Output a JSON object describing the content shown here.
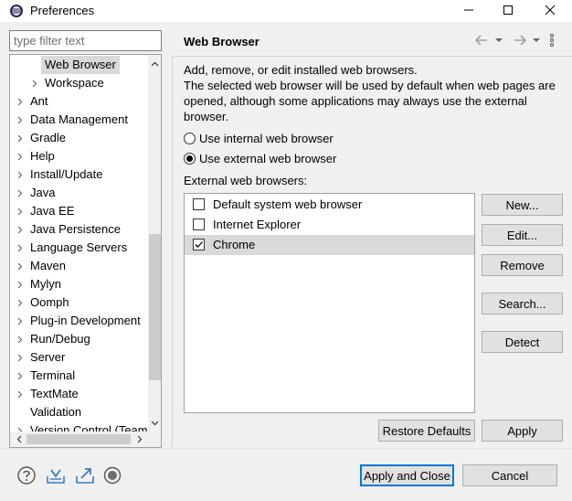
{
  "window": {
    "title": "Preferences",
    "icon": "eclipse-icon",
    "controls": {
      "minimize": "minimize-icon",
      "maximize": "maximize-icon",
      "close": "close-icon"
    }
  },
  "filter": {
    "placeholder": "type filter text",
    "value": ""
  },
  "tree": {
    "items": [
      {
        "label": "Web Browser",
        "expandable": false,
        "selected": true
      },
      {
        "label": "Workspace",
        "expandable": true
      },
      {
        "label": "Ant",
        "expandable": true
      },
      {
        "label": "Data Management",
        "expandable": true
      },
      {
        "label": "Gradle",
        "expandable": true
      },
      {
        "label": "Help",
        "expandable": true
      },
      {
        "label": "Install/Update",
        "expandable": true
      },
      {
        "label": "Java",
        "expandable": true
      },
      {
        "label": "Java EE",
        "expandable": true
      },
      {
        "label": "Java Persistence",
        "expandable": true
      },
      {
        "label": "Language Servers",
        "expandable": true
      },
      {
        "label": "Maven",
        "expandable": true
      },
      {
        "label": "Mylyn",
        "expandable": true
      },
      {
        "label": "Oomph",
        "expandable": true
      },
      {
        "label": "Plug-in Development",
        "expandable": true
      },
      {
        "label": "Run/Debug",
        "expandable": true
      },
      {
        "label": "Server",
        "expandable": true
      },
      {
        "label": "Terminal",
        "expandable": true
      },
      {
        "label": "TextMate",
        "expandable": true
      },
      {
        "label": "Validation",
        "expandable": false
      },
      {
        "label": "Version Control (Team)",
        "expandable": true
      }
    ]
  },
  "page": {
    "title": "Web Browser",
    "description": "Add, remove, or edit installed web browsers.\nThe selected web browser will be used by default when web pages are opened, although some applications may always use the external browser.",
    "radio_internal": "Use internal web browser",
    "radio_external": "Use external web browser",
    "selected_mode": "external",
    "external_label": "External web browsers:",
    "browsers": [
      {
        "label": "Default system web browser",
        "checked": false,
        "selected": false
      },
      {
        "label": "Internet Explorer",
        "checked": false,
        "selected": false
      },
      {
        "label": "Chrome",
        "checked": true,
        "selected": true
      }
    ],
    "buttons": {
      "new": "New...",
      "edit": "Edit...",
      "remove": "Remove",
      "search": "Search...",
      "detect": "Detect",
      "restore_defaults": "Restore Defaults",
      "apply": "Apply"
    },
    "nav_icons": [
      "back-arrow-icon",
      "dropdown-icon",
      "forward-arrow-icon",
      "dropdown-icon",
      "view-menu-icon"
    ]
  },
  "footer": {
    "icons": [
      "help-icon",
      "import-icon",
      "export-icon",
      "record-icon"
    ],
    "apply_close": "Apply and Close",
    "cancel": "Cancel"
  }
}
